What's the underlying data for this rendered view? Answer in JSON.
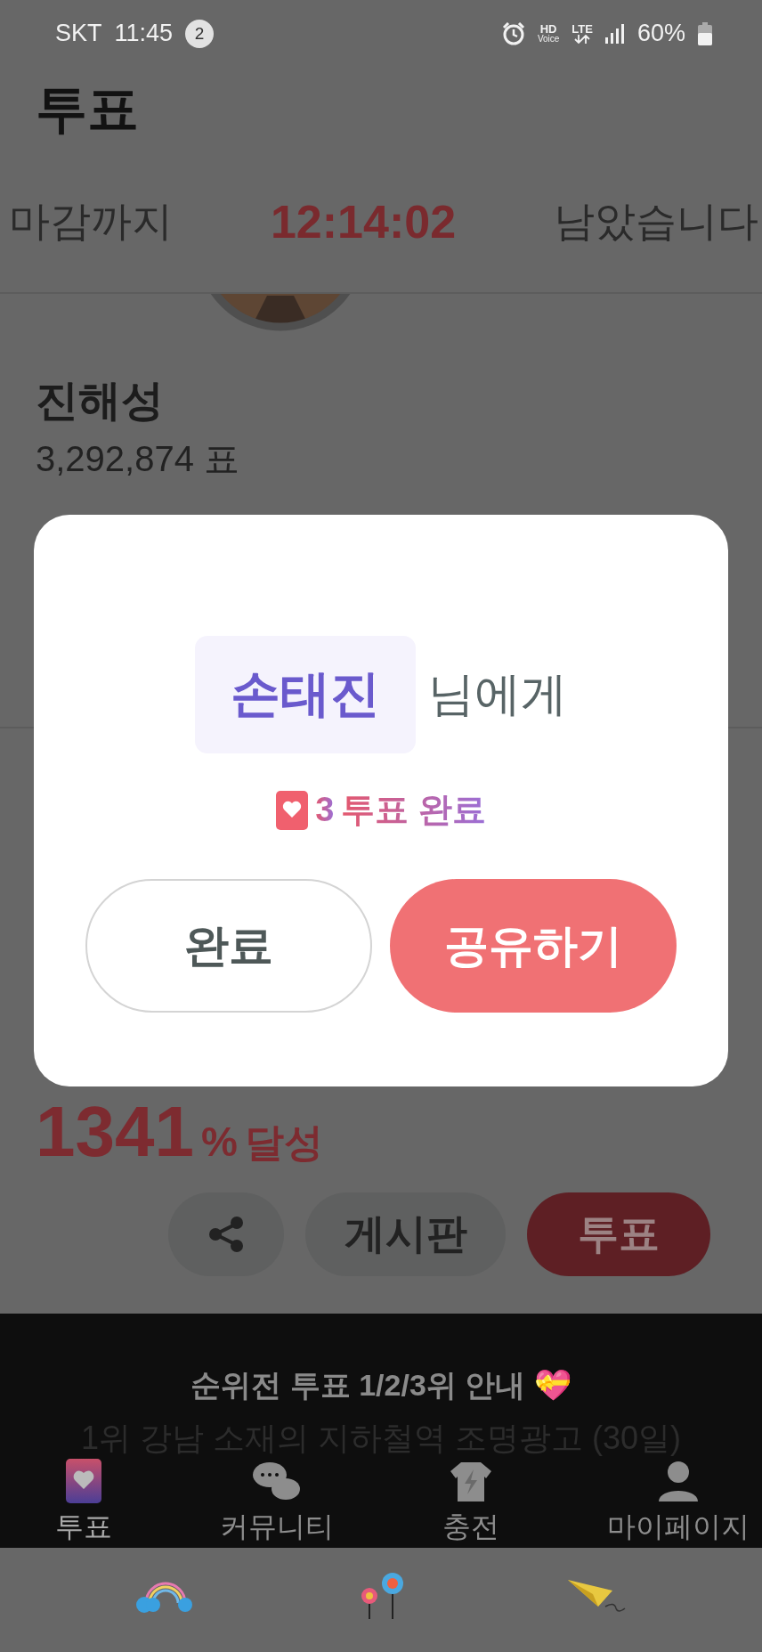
{
  "status_bar": {
    "carrier": "SKT",
    "time": "11:45",
    "notification_count": "2",
    "hd": "HD",
    "voice": "Voice",
    "network": "LTE",
    "battery": "60%"
  },
  "header": {
    "title": "투표"
  },
  "countdown": {
    "prefix": "마감까지",
    "time": "12:14:02",
    "suffix": "남았습니다"
  },
  "candidate": {
    "name": "진해성",
    "votes": "3,292,874 표"
  },
  "goal": {
    "percent": "1341",
    "percent_sign": "%",
    "label": "달성"
  },
  "actions": [
    {
      "kind": "share"
    },
    {
      "kind": "text",
      "label": "게시판"
    },
    {
      "kind": "primary",
      "label": "투표"
    }
  ],
  "banner": {
    "title": "순위전 투표 1/2/3위 안내 💝",
    "lines": [
      "1위 강남 소재의 지하철역 조명광고 (30일)"
    ]
  },
  "tab_bar": [
    {
      "kind": "vote",
      "label": "투표",
      "selected": true
    },
    {
      "kind": "community",
      "label": "커뮤니티",
      "selected": false
    },
    {
      "kind": "charge",
      "label": "충전",
      "selected": false
    },
    {
      "kind": "mypage",
      "label": "마이페이지",
      "selected": false
    }
  ],
  "dialog": {
    "recipient": "손태진",
    "recipient_suffix": "님에게",
    "result_count": "3",
    "result_text": "투표 완료",
    "buttons": [
      {
        "kind": "secondary",
        "label": "완료"
      },
      {
        "kind": "primary",
        "label": "공유하기"
      }
    ]
  }
}
